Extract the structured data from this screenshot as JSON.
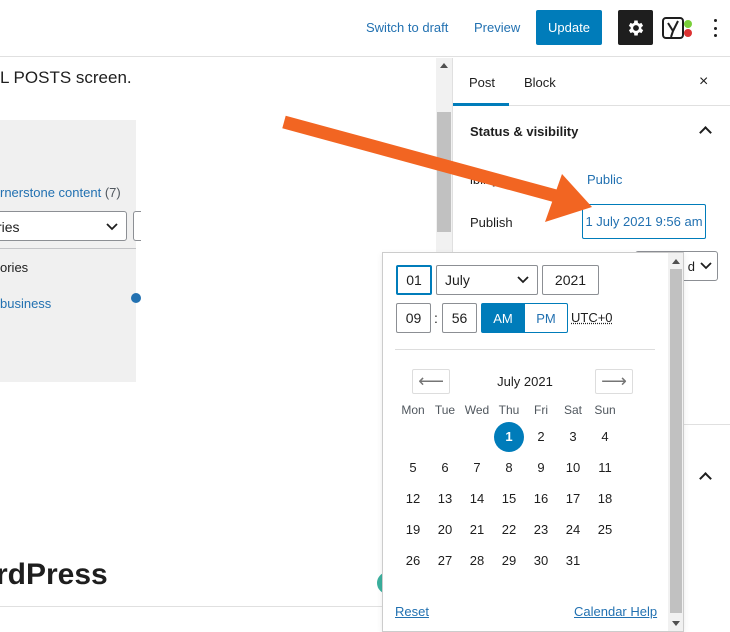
{
  "toolbar": {
    "switch_to_draft": "Switch to draft",
    "preview": "Preview",
    "update": "Update"
  },
  "editor": {
    "intro": "L POSTS screen.",
    "cornerstone_label": "rnerstone content",
    "cornerstone_count": "(7)",
    "category_select_value": "ries",
    "categories_label": "ories",
    "category_item": "business",
    "heading": "rdPress"
  },
  "sidebar": {
    "tab_post": "Post",
    "tab_block": "Block",
    "close": "×",
    "panel_title": "Status & visibility",
    "visibility_label": "ibility",
    "visibility_value": "Public",
    "publish_label": "Publish",
    "publish_value": "1 July 2021 9:56 am",
    "select_partial": "d"
  },
  "datepicker": {
    "day": "01",
    "month": "July",
    "year": "2021",
    "hour": "09",
    "minute": "56",
    "am": "AM",
    "pm": "PM",
    "timezone": "UTC+0",
    "month_title": "July 2021",
    "prev": "⟵",
    "next": "⟶",
    "weekdays": [
      "Mon",
      "Tue",
      "Wed",
      "Thu",
      "Fri",
      "Sat",
      "Sun"
    ],
    "weeks": [
      [
        "",
        "",
        "",
        "1",
        "2",
        "3",
        "4"
      ],
      [
        "5",
        "6",
        "7",
        "8",
        "9",
        "10",
        "11"
      ],
      [
        "12",
        "13",
        "14",
        "15",
        "16",
        "17",
        "18"
      ],
      [
        "19",
        "20",
        "21",
        "22",
        "23",
        "24",
        "25"
      ],
      [
        "26",
        "27",
        "28",
        "29",
        "30",
        "31",
        ""
      ]
    ],
    "selected_day": "1",
    "reset": "Reset",
    "calendar_help": "Calendar Help"
  },
  "colors": {
    "accent": "#007cba",
    "link": "#2271b1",
    "annotation_arrow": "#f26522"
  }
}
